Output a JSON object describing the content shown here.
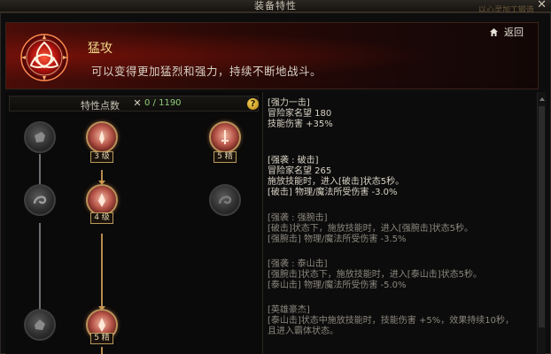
{
  "window": {
    "title": "装备特性",
    "close_glyph": "✕",
    "faint_text": "以心灵加工锻造"
  },
  "header": {
    "skill_name": "猛攻",
    "skill_desc": "可以变得更加猛烈和强力，持续不断地战斗。",
    "back_label": "返回",
    "emblem_icon": "triquetra-emblem-icon",
    "accent": "#c0191a"
  },
  "points": {
    "label": "特性点数",
    "x_glyph": "✕",
    "value": "0 / 1190",
    "help_glyph": "?"
  },
  "nodes": [
    {
      "name": "node-left-1",
      "state": "off"
    },
    {
      "name": "node-mid-1",
      "state": "on",
      "badge": "3 级"
    },
    {
      "name": "node-right-1",
      "state": "on",
      "badge": "5 精"
    },
    {
      "name": "node-left-2",
      "state": "off"
    },
    {
      "name": "node-mid-2",
      "state": "on",
      "badge": "4 级"
    },
    {
      "name": "node-right-2",
      "state": "off"
    },
    {
      "name": "node-left-3",
      "state": "off"
    },
    {
      "name": "node-mid-3",
      "state": "on",
      "badge": "5 精"
    }
  ],
  "info": {
    "b1": {
      "title": "[强力一击]",
      "l1": "冒险家名望 180",
      "l2": "技能伤害 +35%"
    },
    "b2": {
      "title": "[强袭 : 破击]",
      "l1": "冒险家名望 265",
      "l2": "施放技能时，进入[破击]状态5秒。",
      "l3": "[破击]  物理/魔法所受伤害 -3.0%"
    },
    "b3": {
      "title": "[强袭 : 强腕击]",
      "l1": "[破击]状态下，施放技能时，进入[强腕击]状态5秒。",
      "l2": "[强腕击]  物理/魔法所受伤害 -3.5%"
    },
    "b4": {
      "title": "[强袭 : 泰山击]",
      "l1": "[强腕击]状态下，施放技能时，进入[泰山击]状态5秒。",
      "l2": "[泰山击]  物理/魔法所受伤害 -5.0%"
    },
    "b5": {
      "title": "[英雄豪杰]",
      "l1": "[泰山击]状态中施放技能时，技能伤害 +5%，效果持续10秒，",
      "l2": "且进入霸体状态。"
    }
  }
}
